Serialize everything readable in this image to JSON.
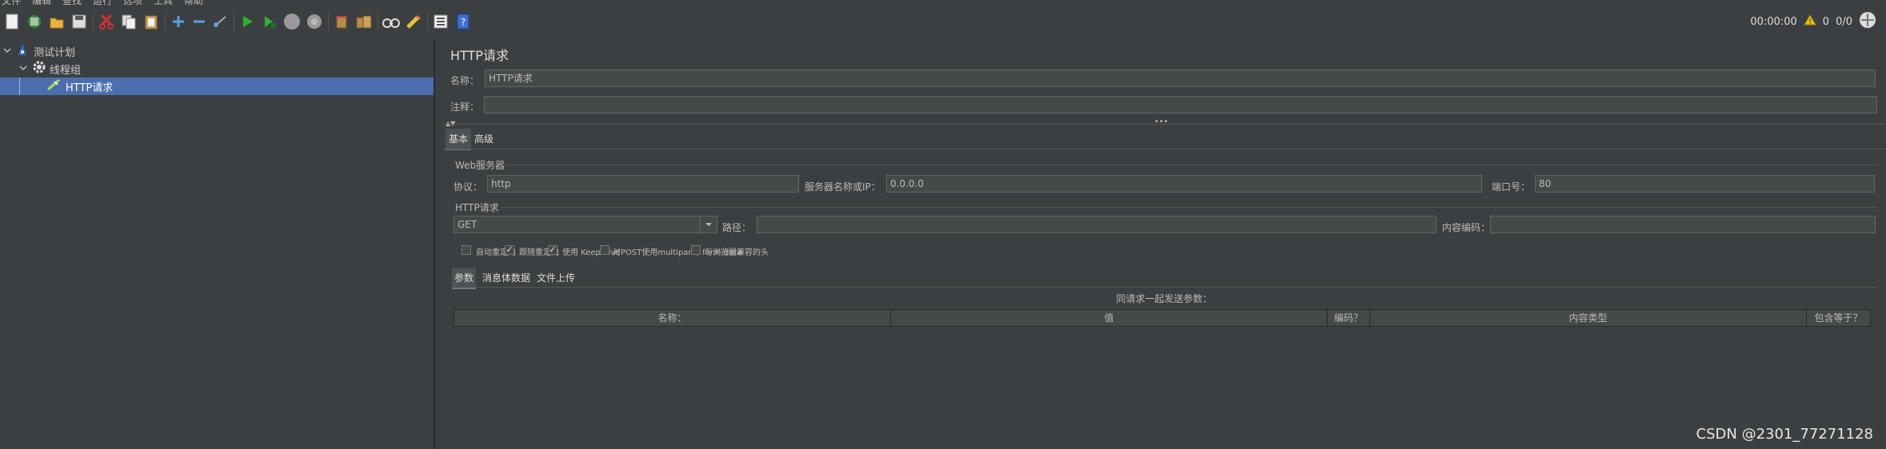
{
  "menubar": {
    "items": [
      "文件",
      "编辑",
      "查找",
      "运行",
      "选项",
      "工具",
      "帮助"
    ]
  },
  "toolbar": {
    "buttons": [
      {
        "icon": "new-file-icon"
      },
      {
        "icon": "templates-icon"
      },
      {
        "icon": "open-folder-icon"
      },
      {
        "icon": "save-icon"
      },
      {
        "icon": "cut-icon"
      },
      {
        "icon": "copy-icon"
      },
      {
        "icon": "paste-icon"
      },
      {
        "icon": "expand-icon"
      },
      {
        "icon": "collapse-icon"
      },
      {
        "icon": "toggle-icon"
      },
      {
        "icon": "start-icon"
      },
      {
        "icon": "start-no-pause-icon"
      },
      {
        "icon": "stop-icon"
      },
      {
        "icon": "shutdown-icon"
      },
      {
        "icon": "clear-icon"
      },
      {
        "icon": "clear-all-icon"
      },
      {
        "icon": "search-icon"
      },
      {
        "icon": "reset-search-icon"
      },
      {
        "icon": "function-helper-icon"
      },
      {
        "icon": "help-icon"
      }
    ],
    "timer": "00:00:00",
    "warning_count": "0",
    "threads": "0/0"
  },
  "tree": {
    "items": [
      {
        "label": "测试计划",
        "icon": "test-plan-icon"
      },
      {
        "label": "线程组",
        "icon": "gear-icon"
      },
      {
        "label": "HTTP请求",
        "icon": "sampler-icon"
      }
    ]
  },
  "form": {
    "title": "HTTP请求",
    "name_label": "名称：",
    "name_value": "HTTP请求",
    "comment_label": "注释：",
    "comment_value": "",
    "tabs": [
      "基本",
      "高级"
    ],
    "web_server_label": "Web服务器",
    "protocol_label": "协议：",
    "protocol_value": "http",
    "server_label": "服务器名称或IP：",
    "server_value": "0.0.0.0",
    "port_label": "端口号：",
    "port_value": "80",
    "http_request_label": "HTTP请求",
    "method_value": "GET",
    "path_label": "路径：",
    "path_value": "",
    "encoding_label": "内容编码：",
    "encoding_value": "",
    "checkboxes": [
      {
        "label": "自动重定向",
        "checked": false
      },
      {
        "label": "跟随重定向",
        "checked": true
      },
      {
        "label": "使用 KeepAlive",
        "checked": true
      },
      {
        "label": "对POST使用multipart / form-data",
        "checked": false
      },
      {
        "label": "与浏览器兼容的头",
        "checked": false
      }
    ],
    "sub_tabs": [
      "参数",
      "消息体数据",
      "文件上传"
    ],
    "params_caption": "同请求一起发送参数：",
    "table_headers": [
      "名称：",
      "值",
      "编码？",
      "内容类型",
      "包含等于？"
    ]
  },
  "watermark": "CSDN @2301_77271128"
}
